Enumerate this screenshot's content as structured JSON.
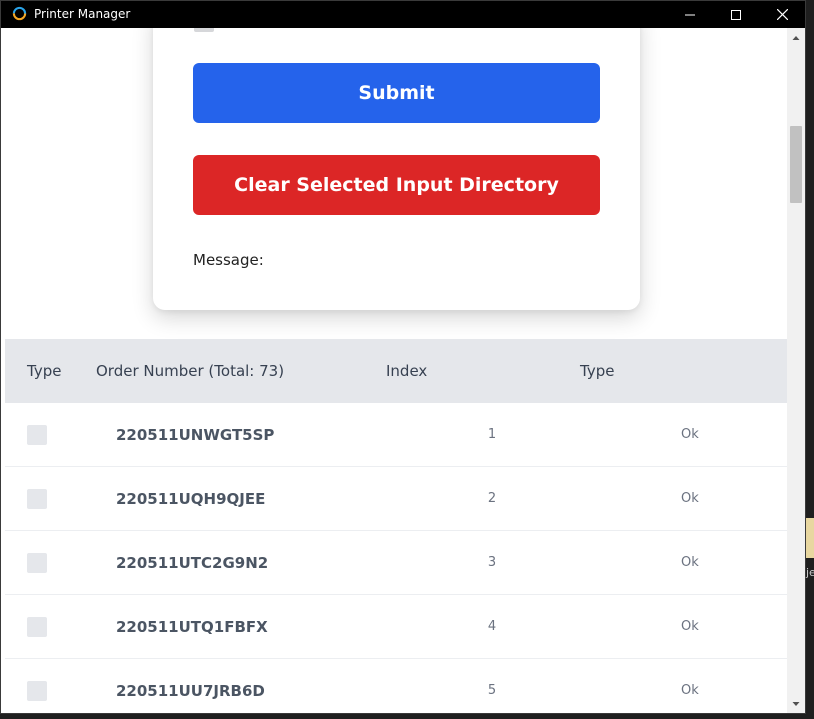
{
  "window": {
    "title": "Printer Manager"
  },
  "form": {
    "submit_label": "Submit",
    "clear_label": "Clear Selected Input Directory",
    "message_label": "Message:"
  },
  "table": {
    "headers": {
      "select": "Type",
      "order": "Order Number (Total: 73)",
      "index": "Index",
      "type": "Type"
    },
    "rows": [
      {
        "order": "220511UNWGT5SP",
        "index": "1",
        "status": "Ok"
      },
      {
        "order": "220511UQH9QJEE",
        "index": "2",
        "status": "Ok"
      },
      {
        "order": "220511UTC2G9N2",
        "index": "3",
        "status": "Ok"
      },
      {
        "order": "220511UTQ1FBFX",
        "index": "4",
        "status": "Ok"
      },
      {
        "order": "220511UU7JRB6D",
        "index": "5",
        "status": "Ok"
      }
    ]
  },
  "desktop": {
    "partial_label": "je"
  },
  "colors": {
    "submit": "#2563eb",
    "clear": "#dc2626",
    "header_bg": "#e5e7eb"
  },
  "icons": {
    "app": "printer-manager-icon",
    "minimize": "minimize-icon",
    "maximize": "maximize-icon",
    "close": "close-icon",
    "scroll_up": "chevron-up-icon",
    "scroll_down": "chevron-down-icon"
  }
}
